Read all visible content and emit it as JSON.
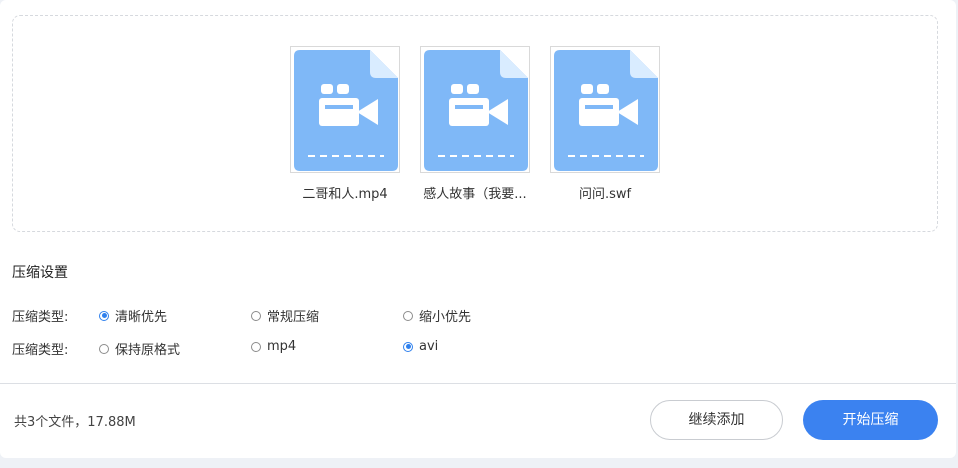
{
  "files": [
    {
      "name": "二哥和人.mp4",
      "icon": "video-file-icon"
    },
    {
      "name": "感人故事（我要...",
      "icon": "video-file-icon"
    },
    {
      "name": "问问.swf",
      "icon": "video-file-icon"
    }
  ],
  "settings": {
    "title": "压缩设置",
    "compress_type": {
      "label": "压缩类型:",
      "options": [
        "清晰优先",
        "常规压缩",
        "缩小优先"
      ],
      "selected": "清晰优先"
    },
    "format_type": {
      "label": "压缩类型:",
      "options": [
        "保持原格式",
        "mp4",
        "avi"
      ],
      "selected": "avi"
    }
  },
  "footer": {
    "summary": "共3个文件，17.88M",
    "continue_label": "继续添加",
    "start_label": "开始压缩"
  },
  "colors": {
    "accent": "#3b82f0",
    "file_icon": "#7fb8f7"
  }
}
